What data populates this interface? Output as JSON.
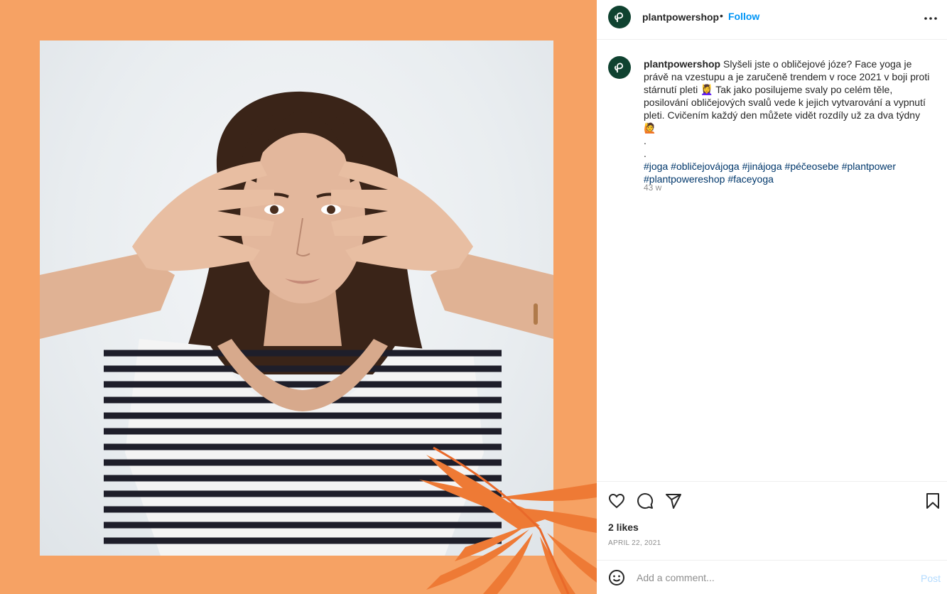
{
  "post": {
    "username": "plantpowershop",
    "follow_label": "Follow",
    "separator": "•",
    "caption_text": "Slyšeli jste o obličejové józe? Face yoga je právě na vzestupu a je zaručeně trendem v roce 2021 v boji proti stárnutí pleti 💆‍♀️ Tak jako posilujeme svaly po celém těle, posilování obličejových svalů vede k jejich vytvarování a vypnutí pleti. Cvičením každý den můžete vidět rozdíly už za dva týdny 🙋",
    "caption_dots": [
      ".",
      "."
    ],
    "hashtags": [
      "#joga",
      "#obličejovájoga",
      "#jinájoga",
      "#péčeosebe",
      "#plantpower",
      "#plantpowereshop",
      "#faceyoga"
    ],
    "time_ago": "43 w",
    "likes": "2 likes",
    "date": "APRIL 22, 2021"
  },
  "comment": {
    "placeholder": "Add a comment...",
    "post_label": "Post"
  },
  "icons": {
    "more": "more-options-icon",
    "like": "heart-icon",
    "comment": "comment-icon",
    "share": "share-icon",
    "save": "bookmark-icon",
    "emoji": "emoji-icon",
    "avatar": "leaf-logo-icon"
  },
  "colors": {
    "media_bg": "#f6a264",
    "avatar_bg": "#0f4230",
    "follow": "#0095f6",
    "hashtag": "#00376b",
    "muted": "#8e8e8e",
    "post_disabled": "#b3dbff"
  }
}
